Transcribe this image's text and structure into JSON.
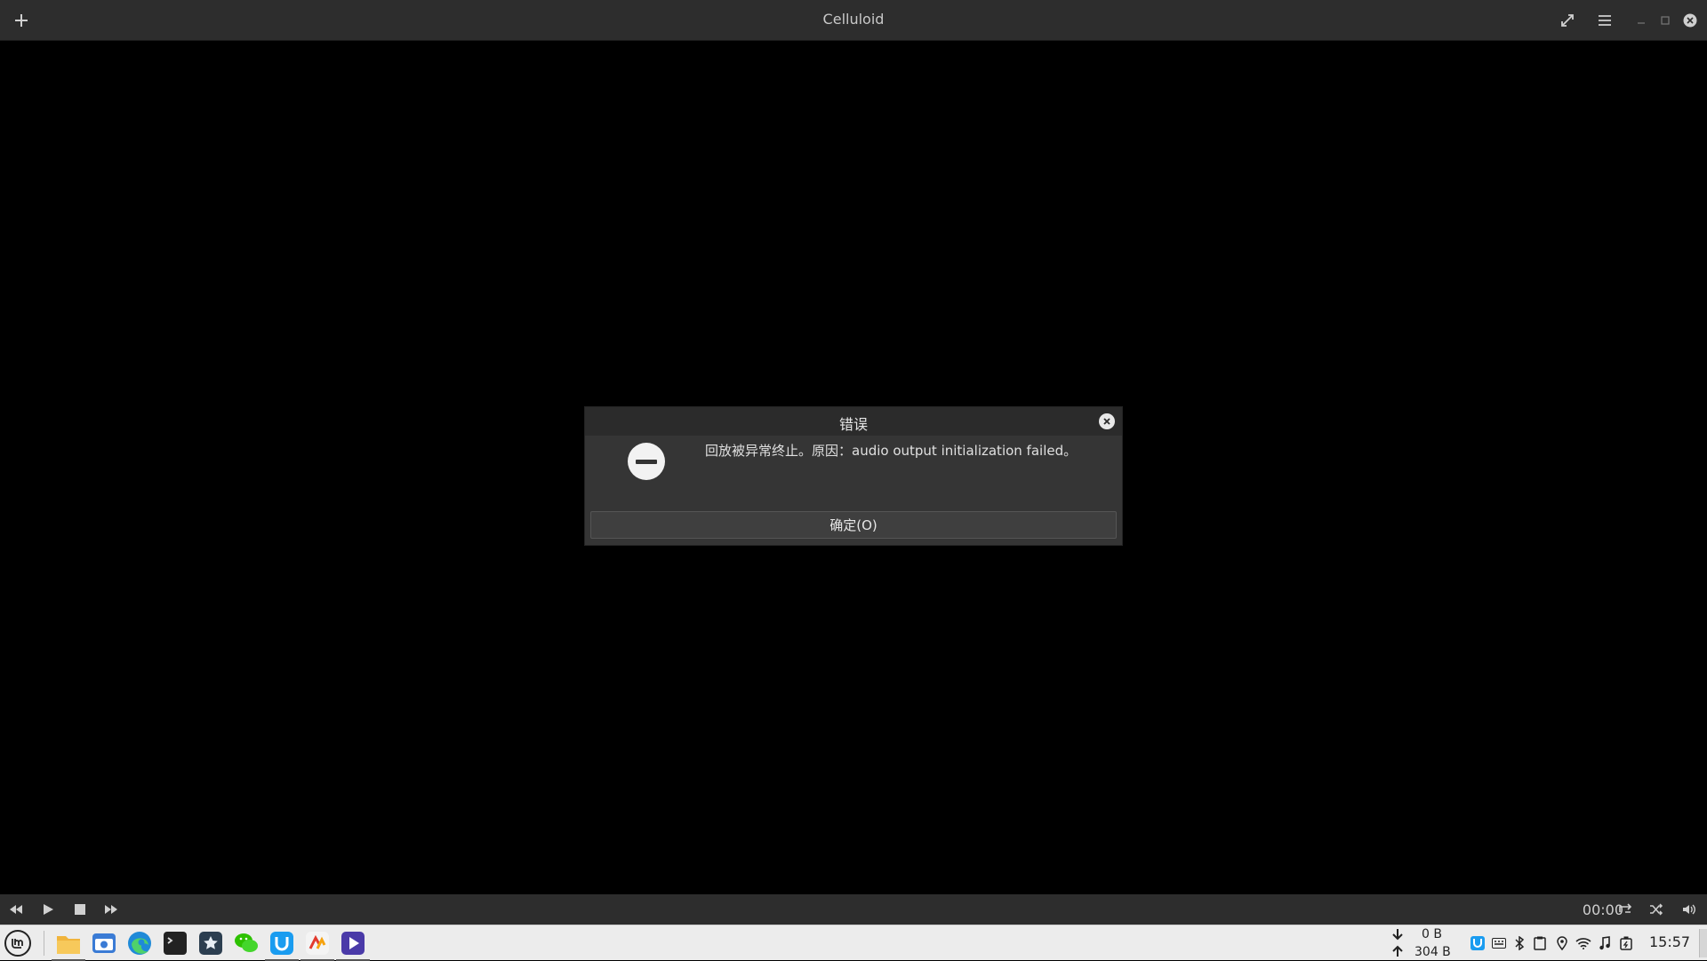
{
  "window": {
    "title": "Celluloid"
  },
  "dialog": {
    "title": "错误",
    "message": "回放被异常终止。原因：audio output initialization failed。",
    "ok_label": "确定(O)"
  },
  "controls": {
    "time": "00:00"
  },
  "taskbar": {
    "apps": [
      {
        "name": "files-app",
        "color": "#f0b43c"
      },
      {
        "name": "screenshot-app",
        "color": "#3a7bd5"
      },
      {
        "name": "edge-browser-app",
        "color": "#1f8ad8"
      },
      {
        "name": "terminal-app",
        "color": "#222222"
      },
      {
        "name": "appimage-launcher-app",
        "color": "#2c3e50"
      },
      {
        "name": "wechat-app",
        "color": "#2dc100"
      },
      {
        "name": "tuanjie-app",
        "color": "#1a9cf0"
      },
      {
        "name": "wps-app",
        "color": "#e8e8e8"
      },
      {
        "name": "celluloid-app",
        "color": "#4a3aa8"
      }
    ],
    "net_down": "0 B",
    "net_up": "304 B",
    "clock": "15:57"
  }
}
